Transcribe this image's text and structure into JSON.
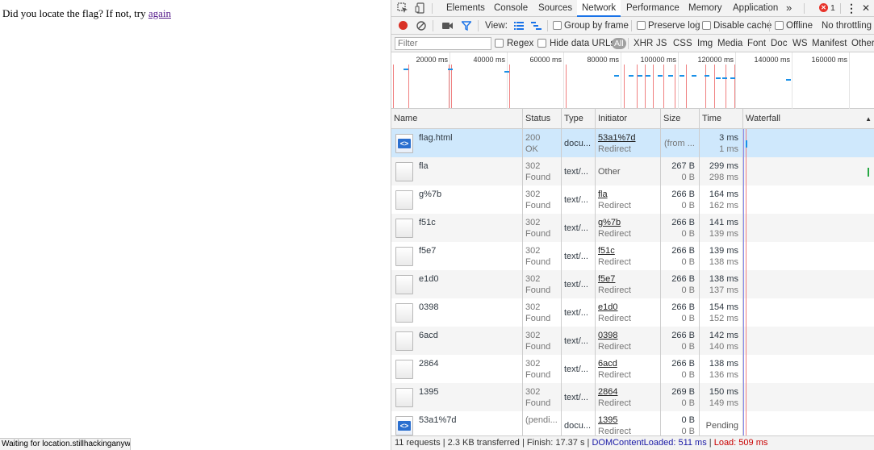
{
  "page": {
    "text_before_link": "Did you locate the flag? If not, try ",
    "link_text": "again",
    "status_text": "Waiting for location.stillhackinganyw"
  },
  "devtools": {
    "tabs": [
      "Elements",
      "Console",
      "Sources",
      "Network",
      "Performance",
      "Memory",
      "Application"
    ],
    "active_tab": "Network",
    "more_tabs": "»",
    "error_count": "1",
    "close": "✕",
    "kebab": "⋮",
    "toolbar": {
      "view_label": "View:",
      "group_by_frame": "Group by frame",
      "preserve_log": "Preserve log",
      "disable_cache": "Disable cache",
      "offline": "Offline",
      "throttling": "No throttling"
    },
    "filter": {
      "placeholder": "Filter",
      "regex": "Regex",
      "hide_data_urls": "Hide data URLs",
      "all": "All",
      "types": [
        "XHR",
        "JS",
        "CSS",
        "Img",
        "Media",
        "Font",
        "Doc",
        "WS",
        "Manifest",
        "Other"
      ]
    },
    "overview_ticks": [
      "20000 ms",
      "40000 ms",
      "60000 ms",
      "80000 ms",
      "100000 ms",
      "120000 ms",
      "140000 ms",
      "160000 ms"
    ],
    "columns": [
      "Name",
      "Status",
      "Type",
      "Initiator",
      "Size",
      "Time",
      "Waterfall"
    ],
    "sort_indicator": "▲",
    "rows": [
      {
        "name": "flag.html",
        "status": "200",
        "status_text": "OK",
        "type": "docu...",
        "initiator": "53a1%7d",
        "initiator_sub": "Redirect",
        "size": "(from ...",
        "size2": "",
        "time": "3 ms",
        "time2": "1 ms",
        "icon": "html-file-icon"
      },
      {
        "name": "fla",
        "status": "302",
        "status_text": "Found",
        "type": "text/...",
        "initiator": "Other",
        "initiator_sub": "",
        "size": "267 B",
        "size2": "0 B",
        "time": "299 ms",
        "time2": "298 ms",
        "icon": "file-icon"
      },
      {
        "name": "g%7b",
        "status": "302",
        "status_text": "Found",
        "type": "text/...",
        "initiator": "fla",
        "initiator_sub": "Redirect",
        "size": "266 B",
        "size2": "0 B",
        "time": "164 ms",
        "time2": "162 ms",
        "icon": "file-icon"
      },
      {
        "name": "f51c",
        "status": "302",
        "status_text": "Found",
        "type": "text/...",
        "initiator": "g%7b",
        "initiator_sub": "Redirect",
        "size": "266 B",
        "size2": "0 B",
        "time": "141 ms",
        "time2": "139 ms",
        "icon": "file-icon"
      },
      {
        "name": "f5e7",
        "status": "302",
        "status_text": "Found",
        "type": "text/...",
        "initiator": "f51c",
        "initiator_sub": "Redirect",
        "size": "266 B",
        "size2": "0 B",
        "time": "139 ms",
        "time2": "138 ms",
        "icon": "file-icon"
      },
      {
        "name": "e1d0",
        "status": "302",
        "status_text": "Found",
        "type": "text/...",
        "initiator": "f5e7",
        "initiator_sub": "Redirect",
        "size": "266 B",
        "size2": "0 B",
        "time": "138 ms",
        "time2": "137 ms",
        "icon": "file-icon"
      },
      {
        "name": "0398",
        "status": "302",
        "status_text": "Found",
        "type": "text/...",
        "initiator": "e1d0",
        "initiator_sub": "Redirect",
        "size": "266 B",
        "size2": "0 B",
        "time": "154 ms",
        "time2": "152 ms",
        "icon": "file-icon"
      },
      {
        "name": "6acd",
        "status": "302",
        "status_text": "Found",
        "type": "text/...",
        "initiator": "0398",
        "initiator_sub": "Redirect",
        "size": "266 B",
        "size2": "0 B",
        "time": "142 ms",
        "time2": "140 ms",
        "icon": "file-icon"
      },
      {
        "name": "2864",
        "status": "302",
        "status_text": "Found",
        "type": "text/...",
        "initiator": "6acd",
        "initiator_sub": "Redirect",
        "size": "266 B",
        "size2": "0 B",
        "time": "138 ms",
        "time2": "136 ms",
        "icon": "file-icon"
      },
      {
        "name": "1395",
        "status": "302",
        "status_text": "Found",
        "type": "text/...",
        "initiator": "2864",
        "initiator_sub": "Redirect",
        "size": "269 B",
        "size2": "0 B",
        "time": "150 ms",
        "time2": "149 ms",
        "icon": "file-icon"
      },
      {
        "name": "53a1%7d",
        "status": "(pendi...",
        "status_text": "",
        "type": "docu...",
        "initiator": "1395",
        "initiator_sub": "Redirect",
        "size": "0 B",
        "size2": "0 B",
        "time": "Pending",
        "time2": "",
        "icon": "html-file-icon"
      }
    ],
    "summary": {
      "requests": "11 requests",
      "transferred": "2.3 KB transferred",
      "finish": "Finish: 17.37 s",
      "dcl": "DOMContentLoaded: 511 ms",
      "load": "Load: 509 ms"
    },
    "colors": {
      "accent": "#1a73e8",
      "record": "#d93025",
      "dcl": "#1a1aa6",
      "load": "#c80000",
      "selected_row": "#cfe8fc"
    }
  }
}
